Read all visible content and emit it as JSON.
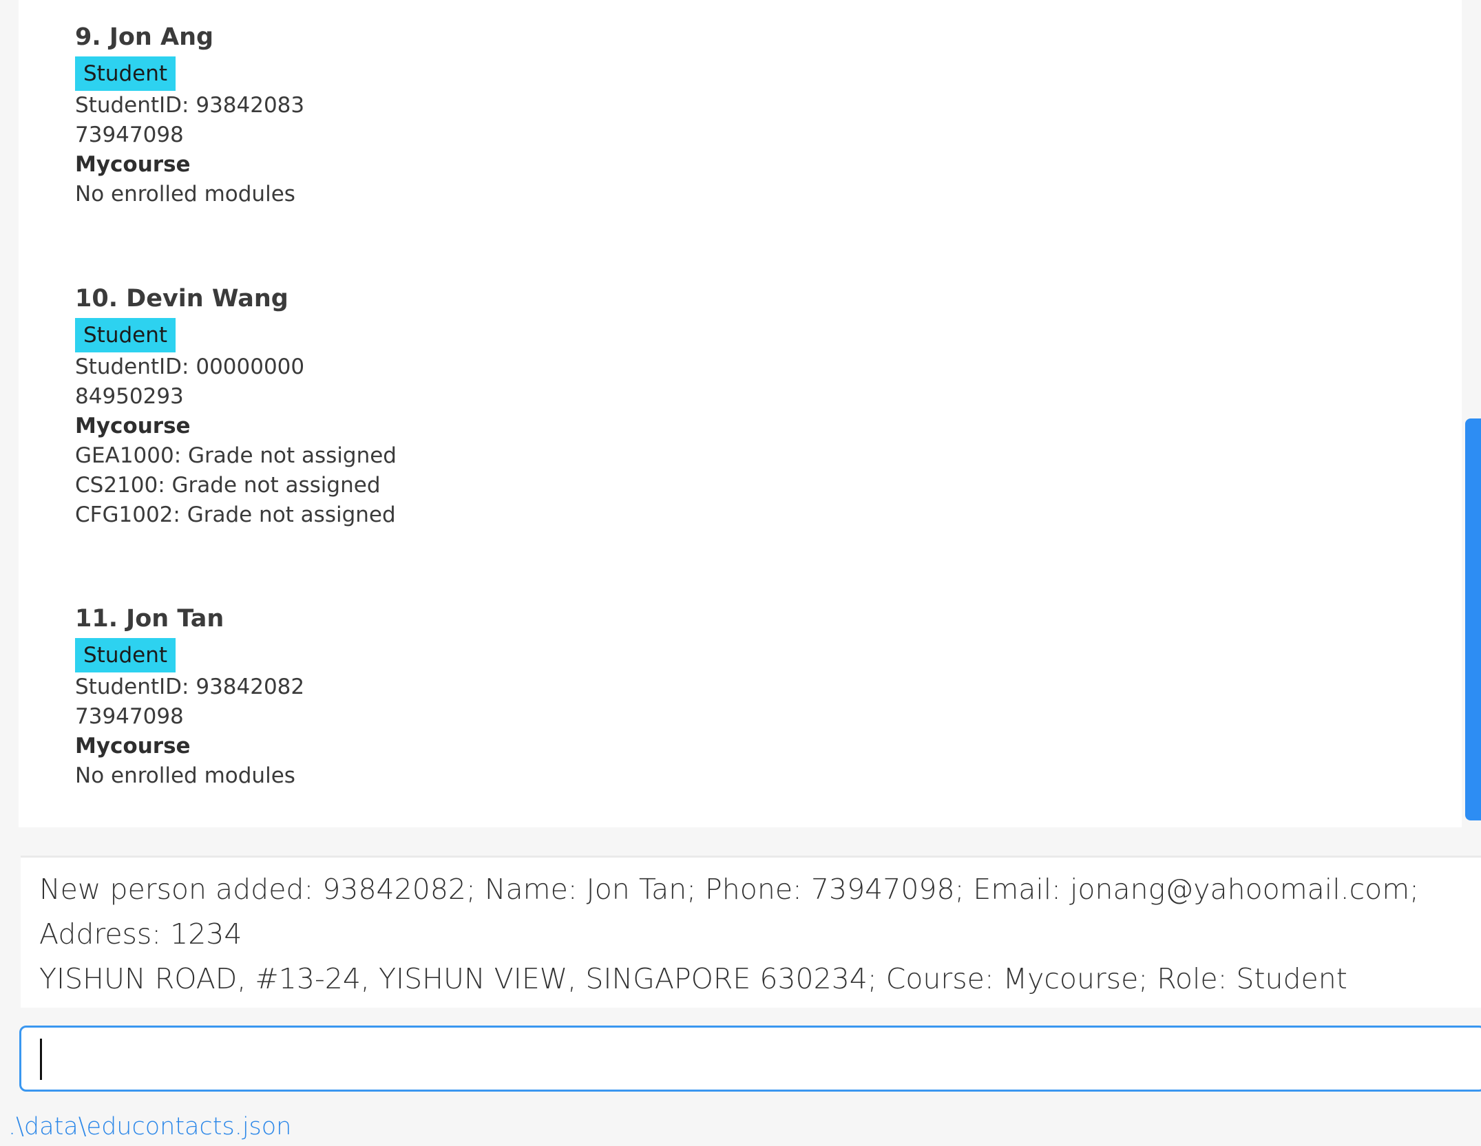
{
  "person_list": [
    {
      "title": "9.  Jon Ang",
      "role": "Student",
      "student_id": "StudentID: 93842083",
      "phone": "73947098",
      "course": "Mycourse",
      "modules": [
        "No enrolled modules"
      ]
    },
    {
      "title": "10.  Devin Wang",
      "role": "Student",
      "student_id": "StudentID: 00000000",
      "phone": "84950293",
      "course": "Mycourse",
      "modules": [
        "GEA1000: Grade not assigned",
        "CS2100: Grade not assigned",
        "CFG1002: Grade not assigned"
      ]
    },
    {
      "title": "11.  Jon Tan",
      "role": "Student",
      "student_id": "StudentID: 93842082",
      "phone": "73947098",
      "course": "Mycourse",
      "modules": [
        "No enrolled modules"
      ]
    }
  ],
  "result_display": {
    "text": "New person added: 93842082; Name: Jon Tan; Phone: 73947098; Email: jonang@yahoomail.com; Address: 1234\nYISHUN ROAD, #13-24, YISHUN VIEW, SINGAPORE 630234; Course: Mycourse; Role: Student"
  },
  "command_box": {
    "value": ""
  },
  "status_bar": {
    "file_path": ".\\data\\educontacts.json"
  },
  "colors": {
    "role_tag": "#2dd2f0",
    "accent": "#3a97f0",
    "status_text": "#2b87e8"
  }
}
